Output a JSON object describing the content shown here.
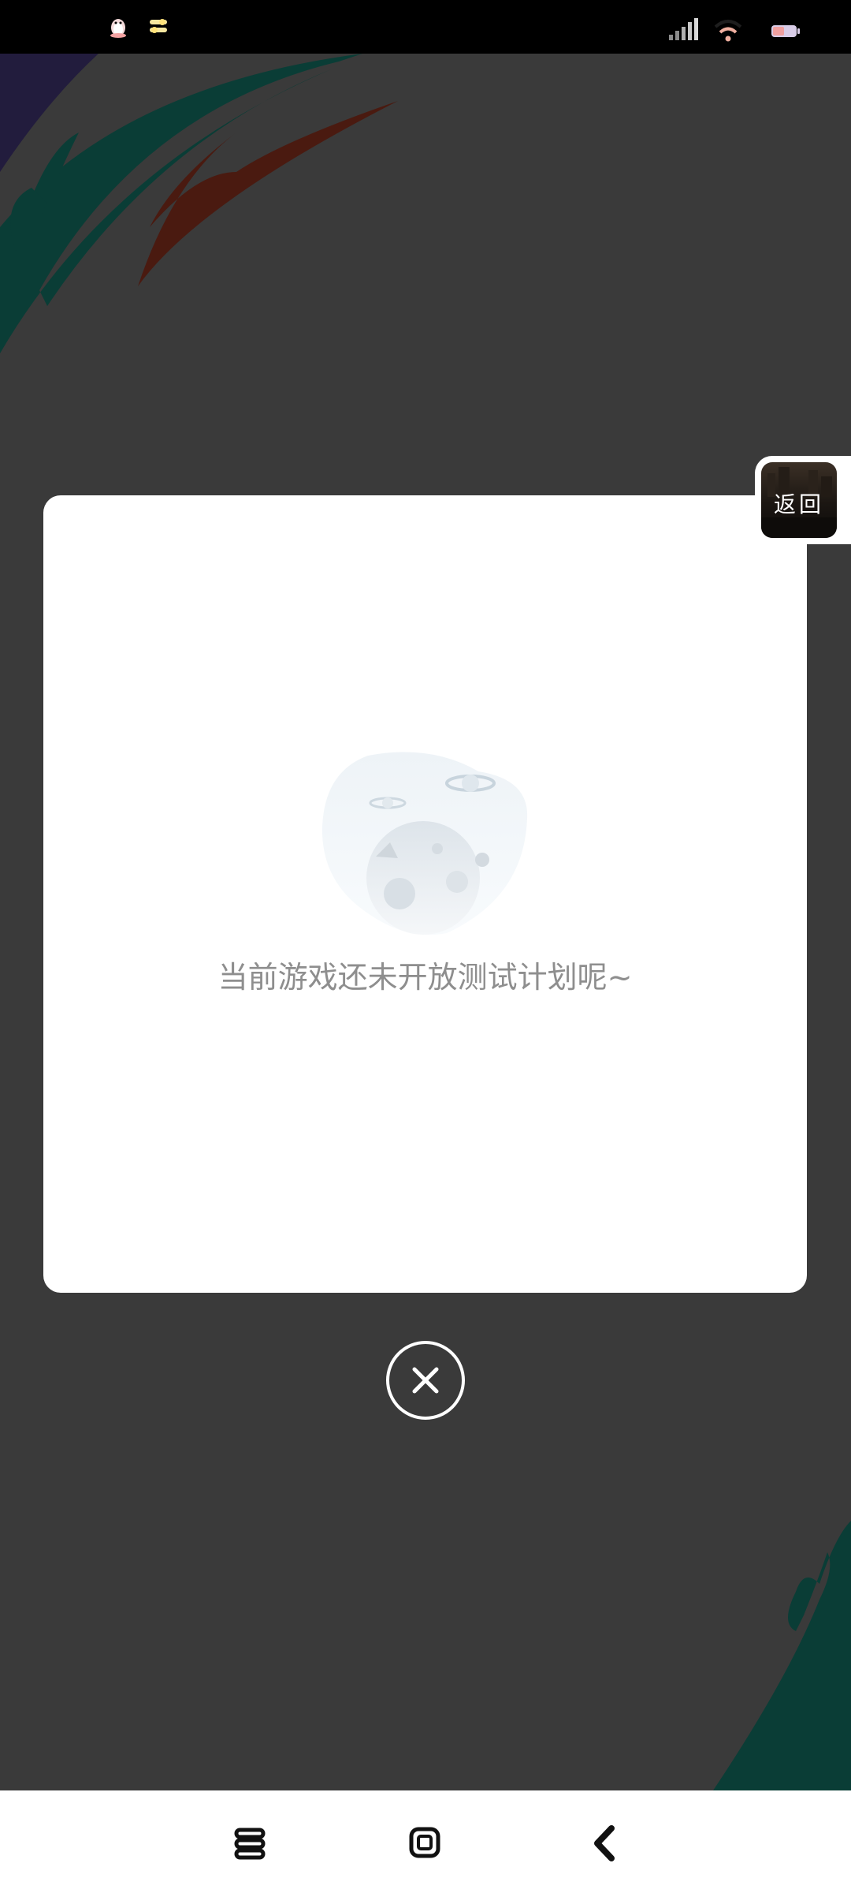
{
  "status_bar": {
    "left_icons": [
      "qq-penguin-icon",
      "toggle-settings-icon"
    ],
    "right_icons": [
      "cellular-signal-icon",
      "wifi-icon",
      "battery-icon"
    ]
  },
  "modal": {
    "illustration": "empty-planet-illustration",
    "message": "当前游戏还未开放测试计划呢~"
  },
  "close_button": {
    "icon": "close-icon"
  },
  "floating_back": {
    "label": "返回"
  },
  "nav_bar": {
    "buttons": [
      "menu-icon",
      "home-icon",
      "back-icon"
    ]
  },
  "colors": {
    "backdrop": "#3a3a3a",
    "card": "#ffffff",
    "message_text": "#8e8e8e",
    "accent_teal": "#0a3d36",
    "accent_rust": "#4a1a10",
    "accent_purple": "#221c3d"
  }
}
